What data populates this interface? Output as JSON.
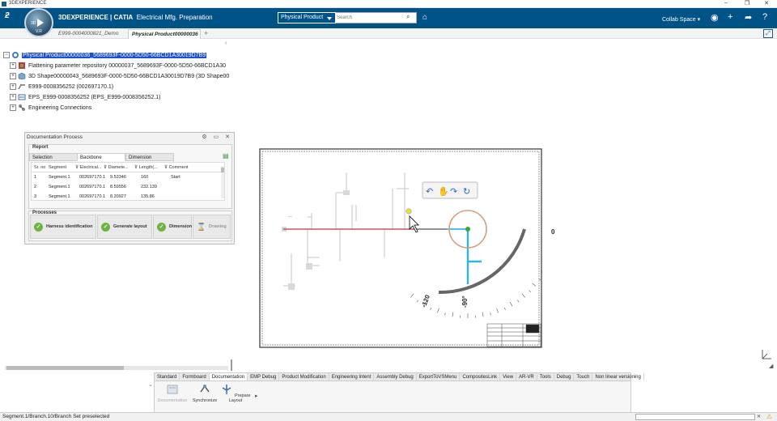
{
  "window": {
    "title": "3DEXPERIENCE"
  },
  "header": {
    "brand_bold": "3DEXPERIENCE | CATIA",
    "brand_app": "Electrical Mfg. Preparation",
    "compass_version": "V.R",
    "compass_num": "3D",
    "search_context": "Physical Product",
    "search_placeholder": "Search",
    "collab_space": "Collab Space"
  },
  "tabs": [
    {
      "label": "E999-0004000821_Demo"
    },
    {
      "label": "Physical Product00000036"
    }
  ],
  "tree": {
    "items": [
      {
        "label": "Physical Product00000036_5689693F-0000-5D50-66BCD1A30019D7B9"
      },
      {
        "label": "Flattening parameter repository 00000037_5689693F-0000-5D50-66BCD1A30"
      },
      {
        "label": "3D Shape00000043_5689693F-0000-5D50-66BCD1A30019D7B9 (3D Shape00"
      },
      {
        "label": "E999-0008356252 (002697170.1)"
      },
      {
        "label": "EPS_E999-0008356252 (EPS_E999-0008356252.1)"
      },
      {
        "label": "Engineering Connections"
      }
    ]
  },
  "doc_panel": {
    "title": "Documentation Process",
    "report_label": "Report",
    "tabs": [
      "Selection",
      "Backbone",
      "Dimension"
    ],
    "columns": [
      "Sr. no",
      "Segment",
      "Electrical...",
      "Diamete...",
      "Length(...",
      "Comment"
    ],
    "rows": [
      [
        "1",
        "Segment.1",
        "002697170.1",
        "9.53346",
        "160",
        "Start"
      ],
      [
        "2",
        "Segment.1",
        "002697170.1",
        "8.59556",
        "232.139",
        ""
      ],
      [
        "3",
        "Segment.1",
        "002697170.1",
        "8.20927",
        "135.86",
        ""
      ]
    ],
    "processes_label": "Processes",
    "processes": [
      "Harness identification",
      "Generate layout",
      "Dimension",
      "Drawing"
    ]
  },
  "canvas": {
    "label_0": "0",
    "label_neg90": "-90°",
    "label_neg120": "-120"
  },
  "action_bar": {
    "tabs": [
      "Standard",
      "Formboard",
      "Documentation",
      "EMP Debug",
      "Product Modification",
      "Engineering Intent",
      "Assembly Debug",
      "ExportToVSMenu",
      "CompositesLink",
      "View",
      "AR-VR",
      "Tools",
      "Debug",
      "Touch",
      "Non linear versioning"
    ],
    "active_tab": "Documentation",
    "commands": [
      "Documentation",
      "Synchronize",
      "Prepare Layout"
    ]
  },
  "status": {
    "text": "Segment.1/Branch.10/Branch Set preselected"
  },
  "colors": {
    "header_bg": "#005386",
    "selection": "#1a4fd6",
    "check_green": "#6db33f",
    "harness_cyan": "#2bb6e6",
    "harness_red": "#b4384a"
  }
}
